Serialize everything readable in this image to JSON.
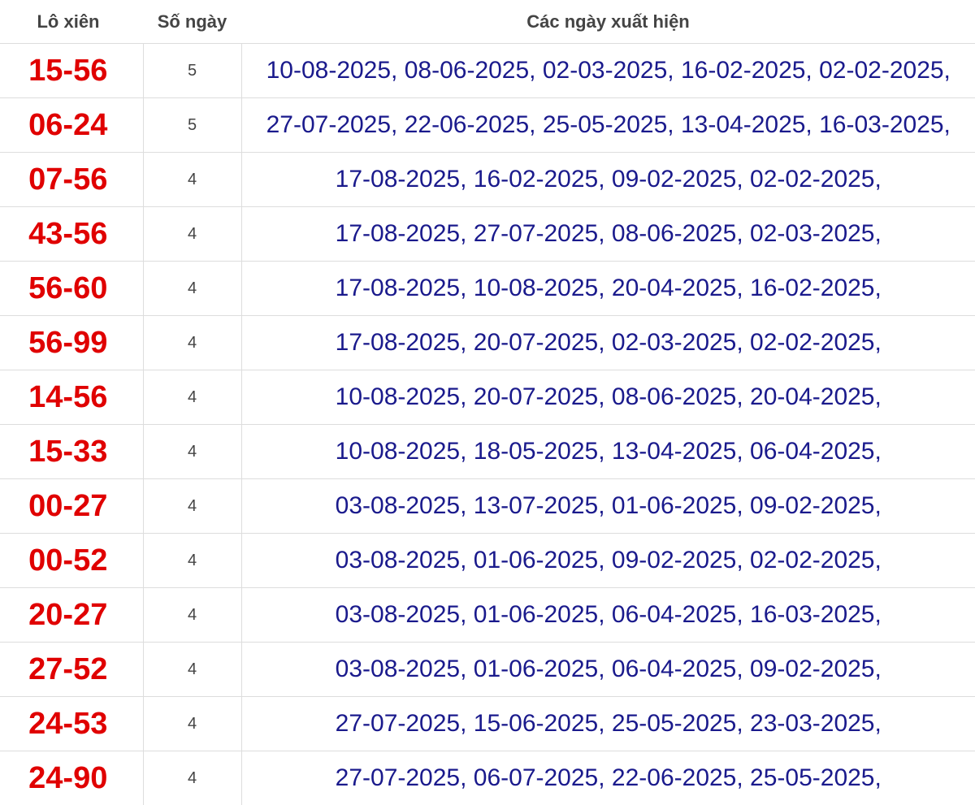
{
  "header": {
    "pair": "Lô xiên",
    "count": "Số ngày",
    "dates": "Các ngày xuất hiện"
  },
  "colors": {
    "pair_text": "#e00000",
    "dates_text": "#1a1a8c",
    "count_text": "#444444",
    "grid": "#dddddd"
  },
  "rows": [
    {
      "pair": "15-56",
      "count": "5",
      "dates": "10-08-2025, 08-06-2025, 02-03-2025, 16-02-2025, 02-02-2025,"
    },
    {
      "pair": "06-24",
      "count": "5",
      "dates": "27-07-2025, 22-06-2025, 25-05-2025, 13-04-2025, 16-03-2025,"
    },
    {
      "pair": "07-56",
      "count": "4",
      "dates": "17-08-2025, 16-02-2025, 09-02-2025, 02-02-2025,"
    },
    {
      "pair": "43-56",
      "count": "4",
      "dates": "17-08-2025, 27-07-2025, 08-06-2025, 02-03-2025,"
    },
    {
      "pair": "56-60",
      "count": "4",
      "dates": "17-08-2025, 10-08-2025, 20-04-2025, 16-02-2025,"
    },
    {
      "pair": "56-99",
      "count": "4",
      "dates": "17-08-2025, 20-07-2025, 02-03-2025, 02-02-2025,"
    },
    {
      "pair": "14-56",
      "count": "4",
      "dates": "10-08-2025, 20-07-2025, 08-06-2025, 20-04-2025,"
    },
    {
      "pair": "15-33",
      "count": "4",
      "dates": "10-08-2025, 18-05-2025, 13-04-2025, 06-04-2025,"
    },
    {
      "pair": "00-27",
      "count": "4",
      "dates": "03-08-2025, 13-07-2025, 01-06-2025, 09-02-2025,"
    },
    {
      "pair": "00-52",
      "count": "4",
      "dates": "03-08-2025, 01-06-2025, 09-02-2025, 02-02-2025,"
    },
    {
      "pair": "20-27",
      "count": "4",
      "dates": "03-08-2025, 01-06-2025, 06-04-2025, 16-03-2025,"
    },
    {
      "pair": "27-52",
      "count": "4",
      "dates": "03-08-2025, 01-06-2025, 06-04-2025, 09-02-2025,"
    },
    {
      "pair": "24-53",
      "count": "4",
      "dates": "27-07-2025, 15-06-2025, 25-05-2025, 23-03-2025,"
    },
    {
      "pair": "24-90",
      "count": "4",
      "dates": "27-07-2025, 06-07-2025, 22-06-2025, 25-05-2025,"
    }
  ]
}
